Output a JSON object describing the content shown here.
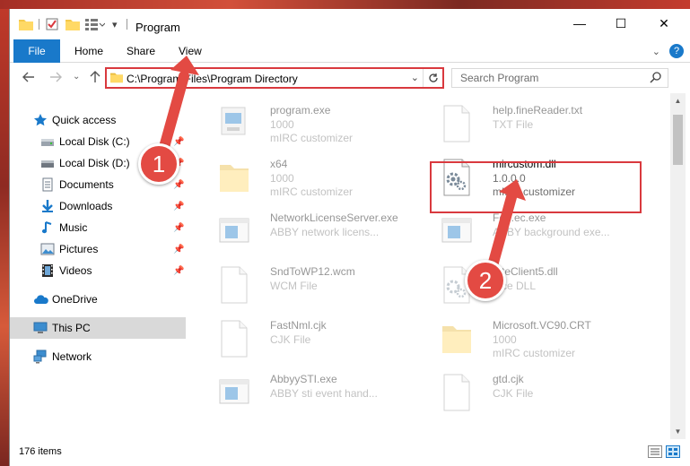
{
  "window": {
    "title": "Program",
    "minimize": "—",
    "maximize": "☐",
    "close": "✕"
  },
  "ribbon": {
    "tabs": [
      "File",
      "Home",
      "Share",
      "View"
    ],
    "help": "?"
  },
  "address": {
    "path": "C:\\Program Files\\Program Directory",
    "search_placeholder": "Search Program"
  },
  "sidebar": {
    "items": [
      {
        "label": "Quick access",
        "icon": "star-icon",
        "pinned": false
      },
      {
        "label": "Local Disk (C:)",
        "icon": "drive-icon",
        "pinned": true
      },
      {
        "label": "Local Disk (D:)",
        "icon": "drive-icon",
        "pinned": true
      },
      {
        "label": "Documents",
        "icon": "documents-icon",
        "pinned": true
      },
      {
        "label": "Downloads",
        "icon": "download-icon",
        "pinned": true
      },
      {
        "label": "Music",
        "icon": "music-icon",
        "pinned": true
      },
      {
        "label": "Pictures",
        "icon": "pictures-icon",
        "pinned": true
      },
      {
        "label": "Videos",
        "icon": "videos-icon",
        "pinned": true
      },
      {
        "label": "OneDrive",
        "icon": "cloud-icon",
        "pinned": false
      },
      {
        "label": "This PC",
        "icon": "computer-icon",
        "pinned": false,
        "selected": true
      },
      {
        "label": "Network",
        "icon": "network-icon",
        "pinned": false
      }
    ]
  },
  "files": [
    {
      "name": "program.exe",
      "line2": "1000",
      "line3": "mIRC customizer",
      "icon": "exe-icon"
    },
    {
      "name": "help.fineReader.txt",
      "line2": "TXT File",
      "line3": "",
      "icon": "text-file-icon"
    },
    {
      "name": "x64",
      "line2": "1000",
      "line3": "mIRC customizer",
      "icon": "folder-icon"
    },
    {
      "name": "mircustom.dll",
      "line2": "1.0.0.0",
      "line3": "mIRC customizer",
      "icon": "dll-gear-icon"
    },
    {
      "name": "NetworkLicenseServer.exe",
      "line2": "ABBY network licens...",
      "line3": "",
      "icon": "app-window-icon"
    },
    {
      "name": "Fe...ec.exe",
      "line2": "ABBY background exe...",
      "line3": "",
      "icon": "app-window-icon"
    },
    {
      "name": "SndToWP12.wcm",
      "line2": "WCM File",
      "line3": "",
      "icon": "blank-file-icon"
    },
    {
      "name": "...teClient5.dll",
      "line2": "...ce DLL",
      "line3": "",
      "icon": "dll-gear-icon"
    },
    {
      "name": "FastNml.cjk",
      "line2": "CJK File",
      "line3": "",
      "icon": "blank-file-icon"
    },
    {
      "name": "Microsoft.VC90.CRT",
      "line2": "1000",
      "line3": "mIRC customizer",
      "icon": "folder-icon"
    },
    {
      "name": "AbbyySTI.exe",
      "line2": "ABBY sti event hand...",
      "line3": "",
      "icon": "app-window-icon"
    },
    {
      "name": "gtd.cjk",
      "line2": "CJK File",
      "line3": "",
      "icon": "blank-file-icon"
    }
  ],
  "status": {
    "item_count": "176 items"
  },
  "annotations": {
    "step1": "1",
    "step2": "2"
  },
  "colors": {
    "accent": "#1979ca",
    "highlight": "#d9393e",
    "badge": "#e34a43"
  }
}
